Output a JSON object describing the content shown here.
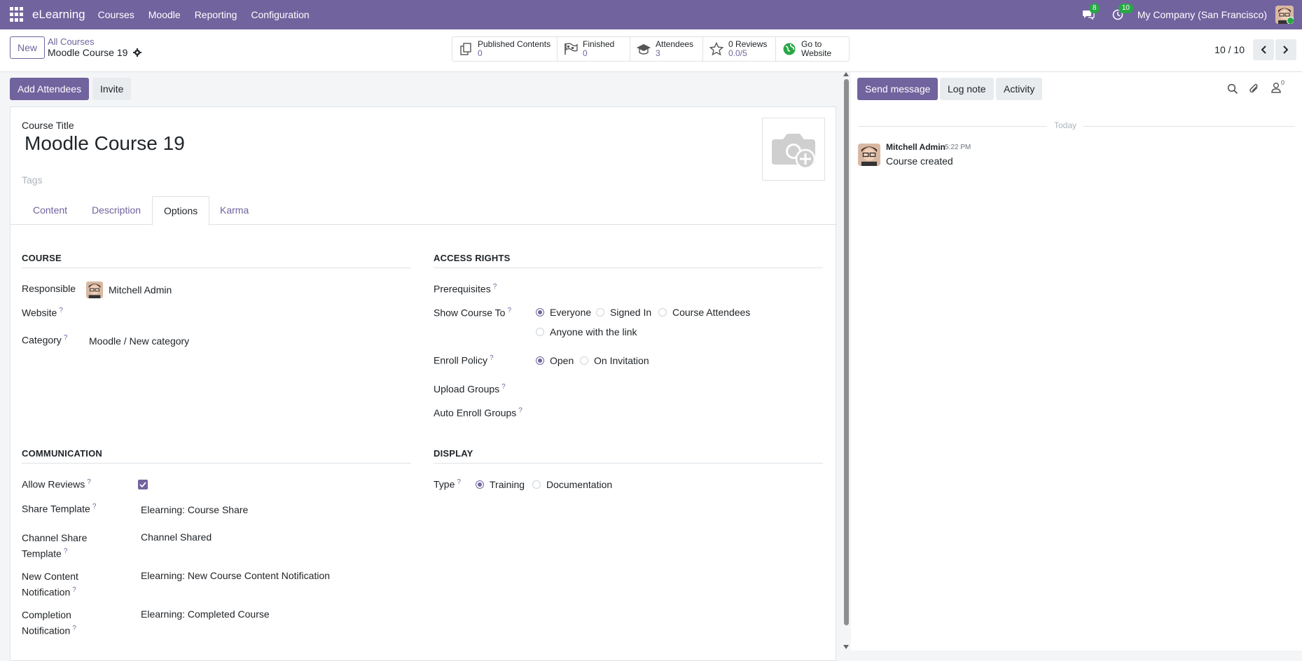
{
  "navbar": {
    "brand": "eLearning",
    "menu": [
      "Courses",
      "Moodle",
      "Reporting",
      "Configuration"
    ],
    "messages_count": "8",
    "activities_count": "10",
    "company": "My Company (San Francisco)"
  },
  "control": {
    "new_label": "New",
    "breadcrumb_parent": "All Courses",
    "breadcrumb_current": "Moodle Course 19",
    "stats": [
      {
        "label": "Published Contents",
        "value": "0"
      },
      {
        "label": "Finished",
        "value": "0"
      },
      {
        "label": "Attendees",
        "value": "3"
      },
      {
        "label": "0 Reviews",
        "value": "0.0/5"
      },
      {
        "label": "Go to",
        "value": "Website"
      }
    ],
    "pager": "10 / 10"
  },
  "form": {
    "add_attendees": "Add Attendees",
    "invite": "Invite",
    "title_label": "Course Title",
    "title_value": "Moodle Course 19",
    "tags_placeholder": "Tags",
    "tabs": [
      "Content",
      "Description",
      "Options",
      "Karma"
    ],
    "course_section": "COURSE",
    "responsible_label": "Responsible",
    "responsible_value": "Mitchell Admin",
    "website_label": "Website",
    "category_label": "Category",
    "category_value": "Moodle / New category",
    "access_section": "ACCESS RIGHTS",
    "prerequisites_label": "Prerequisites",
    "show_course_label": "Show Course To",
    "show_options": [
      "Everyone",
      "Signed In",
      "Course Attendees",
      "Anyone with the link"
    ],
    "enroll_label": "Enroll Policy",
    "enroll_options": [
      "Open",
      "On Invitation"
    ],
    "upload_groups_label": "Upload Groups",
    "auto_enroll_label": "Auto Enroll Groups",
    "communication_section": "COMMUNICATION",
    "allow_reviews_label": "Allow Reviews",
    "share_template_label": "Share Template",
    "share_template_value": "Elearning: Course Share",
    "channel_share_label_1": "Channel Share",
    "channel_share_label_2": "Template",
    "channel_share_value": "Channel Shared",
    "new_content_label_1": "New Content",
    "new_content_label_2": "Notification",
    "new_content_value": "Elearning: New Course Content Notification",
    "completion_label_1": "Completion",
    "completion_label_2": "Notification",
    "completion_value": "Elearning: Completed Course",
    "display_section": "DISPLAY",
    "type_label": "Type",
    "type_options": [
      "Training",
      "Documentation"
    ],
    "question_mark": "?"
  },
  "chatter": {
    "send_message": "Send message",
    "log_note": "Log note",
    "activity": "Activity",
    "followers_count": "0",
    "today": "Today",
    "author": "Mitchell Admin",
    "time": "5:22 PM",
    "body": "Course created"
  },
  "colors": {
    "brand": "#71639e",
    "success": "#28a745"
  }
}
